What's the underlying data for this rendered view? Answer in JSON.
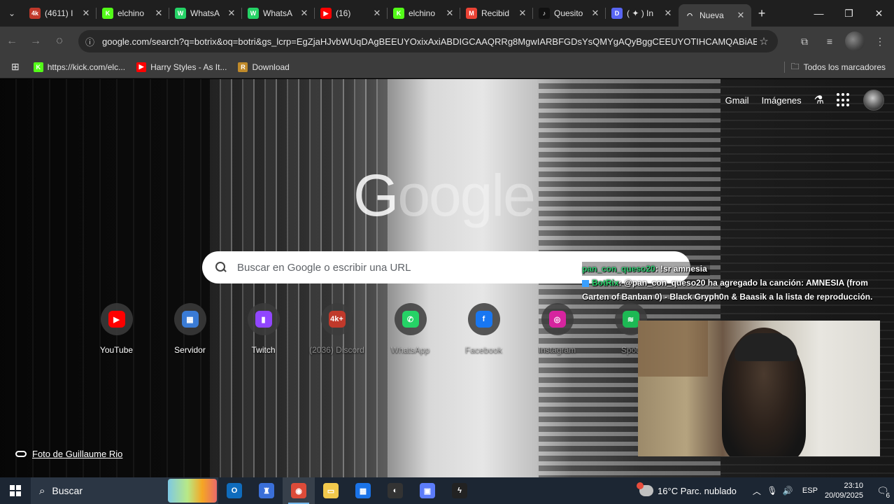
{
  "tabs": [
    {
      "title": "(4611) I",
      "favicon": "4k-icon",
      "color": "#c0392b",
      "fav_text": "4k"
    },
    {
      "title": "elchino",
      "favicon": "kick-icon",
      "color": "#53fc18",
      "fav_text": "K"
    },
    {
      "title": "WhatsA",
      "favicon": "whatsapp-icon",
      "color": "#25d366",
      "fav_text": "W"
    },
    {
      "title": "WhatsA",
      "favicon": "whatsapp-icon",
      "color": "#25d366",
      "fav_text": "W"
    },
    {
      "title": "(16)",
      "favicon": "youtube-icon",
      "color": "#ff0000",
      "fav_text": "▶"
    },
    {
      "title": "elchino",
      "favicon": "kick-icon",
      "color": "#53fc18",
      "fav_text": "K"
    },
    {
      "title": "Recibid",
      "favicon": "gmail-icon",
      "color": "#ea4335",
      "fav_text": "M"
    },
    {
      "title": "Quesito",
      "favicon": "tiktok-icon",
      "color": "#111111",
      "fav_text": "♪"
    },
    {
      "title": "( ✦ ) In",
      "favicon": "discord-icon",
      "color": "#5865f2",
      "fav_text": "D"
    },
    {
      "title": "Nueva",
      "favicon": "loading-icon",
      "color": "#3c3c3c",
      "fav_text": "◠"
    }
  ],
  "toolbar": {
    "url": "google.com/search?q=botrix&oq=botri&gs_lcrp=EgZjaHJvbWUqDAgBEEUYOxixAxiABDIGCAAQRRg8MgwIARBFGDsYsQMYgAQyBggCEEUYOTIHCAMQABiABD..."
  },
  "bookmarks": {
    "items": [
      {
        "label": "https://kick.com/elc...",
        "color": "#53fc18",
        "icon": "K"
      },
      {
        "label": "Harry Styles - As It...",
        "color": "#ff0000",
        "icon": "▶"
      },
      {
        "label": "Download",
        "color": "#c08a2a",
        "icon": "R"
      }
    ],
    "all_label": "Todos los marcadores"
  },
  "ntp": {
    "gmail": "Gmail",
    "images": "Imágenes",
    "logo_a": "G",
    "logo_b": "oogle",
    "search_placeholder": "Buscar en Google o escribir una URL",
    "photo_credit": "Foto de Guillaume Rio",
    "shortcuts": [
      {
        "label": "YouTube",
        "icon": "youtube-icon",
        "color": "#ff0000",
        "glyph": "▶",
        "dim": false
      },
      {
        "label": "Servidor",
        "icon": "server-icon",
        "color": "#3a7bd5",
        "glyph": "▦",
        "dim": false
      },
      {
        "label": "Twitch",
        "icon": "twitch-icon",
        "color": "#9146ff",
        "glyph": "▮",
        "dim": false
      },
      {
        "label": "(2036) Discord",
        "icon": "4k-icon",
        "color": "#c0392b",
        "glyph": "4k+",
        "dim": true
      },
      {
        "label": "WhatsApp",
        "icon": "whatsapp-icon",
        "color": "#25d366",
        "glyph": "✆",
        "dim": true
      },
      {
        "label": "Facebook",
        "icon": "facebook-icon",
        "color": "#1877f2",
        "glyph": "f",
        "dim": true
      },
      {
        "label": "Instagram",
        "icon": "instagram-icon",
        "color": "#d6249f",
        "glyph": "◎",
        "dim": true
      },
      {
        "label": "Spoti",
        "icon": "spotify-icon",
        "color": "#1db954",
        "glyph": "≋",
        "dim": true
      }
    ]
  },
  "chat": {
    "user1": "pan_con_queso20",
    "msg1": ": !sr amnesia",
    "bot": "BotRix",
    "msg2": ": @pan_con_queso20 ha agregado la canción: AMNESIA (from Garten of Banban 0) - Black Gryph0n & Baasik a la lista de reproducción."
  },
  "taskbar": {
    "search_text": "Buscar",
    "apps": [
      {
        "name": "outlook-icon",
        "color": "#0f6cbd",
        "glyph": "O"
      },
      {
        "name": "trophy-icon",
        "color": "#3a6fd8",
        "glyph": "♜"
      },
      {
        "name": "chrome-icon",
        "color": "#dd4b39",
        "glyph": "◉",
        "active": true
      },
      {
        "name": "file-explorer-icon",
        "color": "#f2c94c",
        "glyph": "▭"
      },
      {
        "name": "store-icon",
        "color": "#1a73e8",
        "glyph": "▦"
      },
      {
        "name": "obs-icon",
        "color": "#333333",
        "glyph": "◐"
      },
      {
        "name": "app-icon",
        "color": "#5c7cfa",
        "glyph": "▣"
      },
      {
        "name": "lightning-icon",
        "color": "#222222",
        "glyph": "ϟ"
      }
    ],
    "weather": "16°C  Parc. nublado",
    "lang": "ESP",
    "time": "23:10",
    "date": "20/09/2025",
    "notif_count": "6"
  }
}
